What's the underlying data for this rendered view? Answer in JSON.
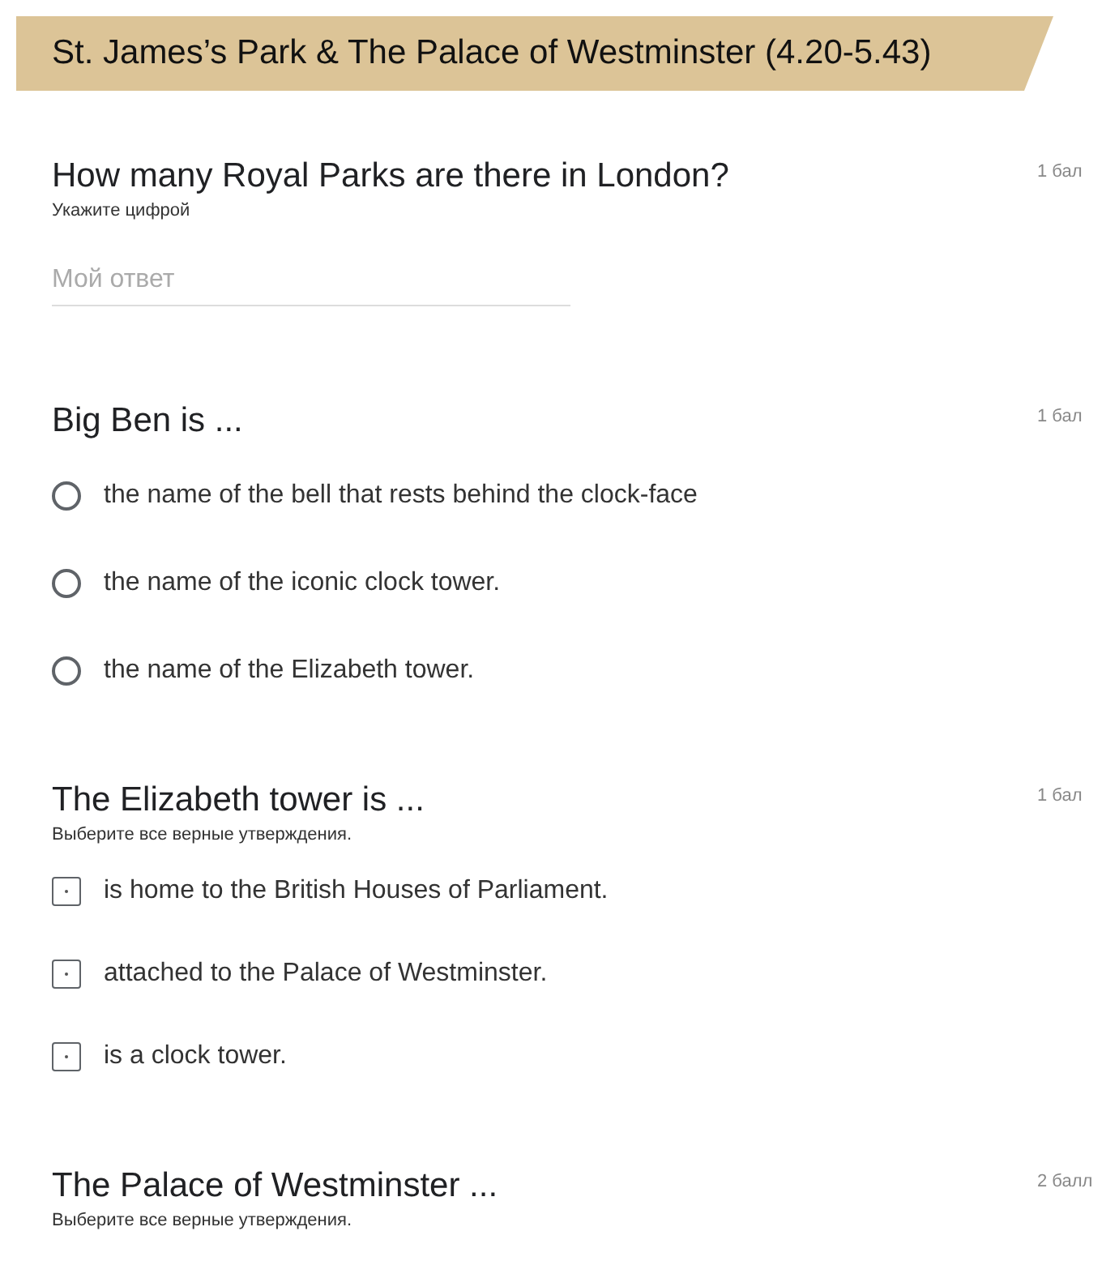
{
  "section": {
    "title": "St. James’s Park & The Palace of Westminster (4.20-5.43)"
  },
  "questions": [
    {
      "kind": "text",
      "title": "How many Royal Parks are there in London?",
      "points": "1 бал",
      "hint": "Укажите цифрой",
      "placeholder": "Мой ответ"
    },
    {
      "kind": "radio",
      "title": "Big Ben is ...",
      "points": "1 бал",
      "options": [
        {
          "label": "the name of the bell that rests behind the clock-face",
          "selected": false
        },
        {
          "label": "the name of the iconic clock tower.",
          "selected": false
        },
        {
          "label": "the name of the Elizabeth tower.",
          "selected": false
        }
      ]
    },
    {
      "kind": "checkbox",
      "title": "The Elizabeth tower is ...",
      "points": "1 бал",
      "hint": "Выберите все верные утверждения.",
      "options": [
        {
          "label": "is home to the British Houses of Parliament.",
          "checked": false
        },
        {
          "label": "attached to the Palace of Westminster.",
          "checked": false
        },
        {
          "label": "is a clock tower.",
          "checked": false
        }
      ]
    },
    {
      "kind": "checkbox",
      "title": "The Palace of Westminster ...",
      "points": "2 балл",
      "hint": "Выберите все верные утверждения."
    }
  ]
}
